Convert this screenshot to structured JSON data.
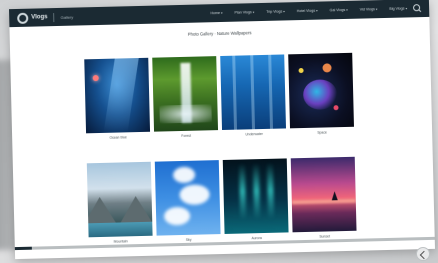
{
  "app": {
    "logo_text": "Vlogs",
    "subtitle": "Gallery"
  },
  "nav": {
    "items": [
      "Home",
      "Plan Vlogs",
      "Trip Vlogs",
      "Hotel Vlogs",
      "Gal Vlogs",
      "Vid Vlogs",
      "Big Vlogs"
    ]
  },
  "page": {
    "title": "Photo Gallery · Nature Wallpapers"
  },
  "gallery": [
    {
      "caption": "Ocean blue",
      "theme": "ocean"
    },
    {
      "caption": "Forest",
      "theme": "forest"
    },
    {
      "caption": "Underwater",
      "theme": "under"
    },
    {
      "caption": "Space",
      "theme": "space"
    },
    {
      "caption": "Mountain",
      "theme": "mount"
    },
    {
      "caption": "Sky",
      "theme": "sky"
    },
    {
      "caption": "Aurora",
      "theme": "aurora"
    },
    {
      "caption": "Sunset",
      "theme": "sunset"
    }
  ],
  "video": {
    "progress": 0.04
  }
}
